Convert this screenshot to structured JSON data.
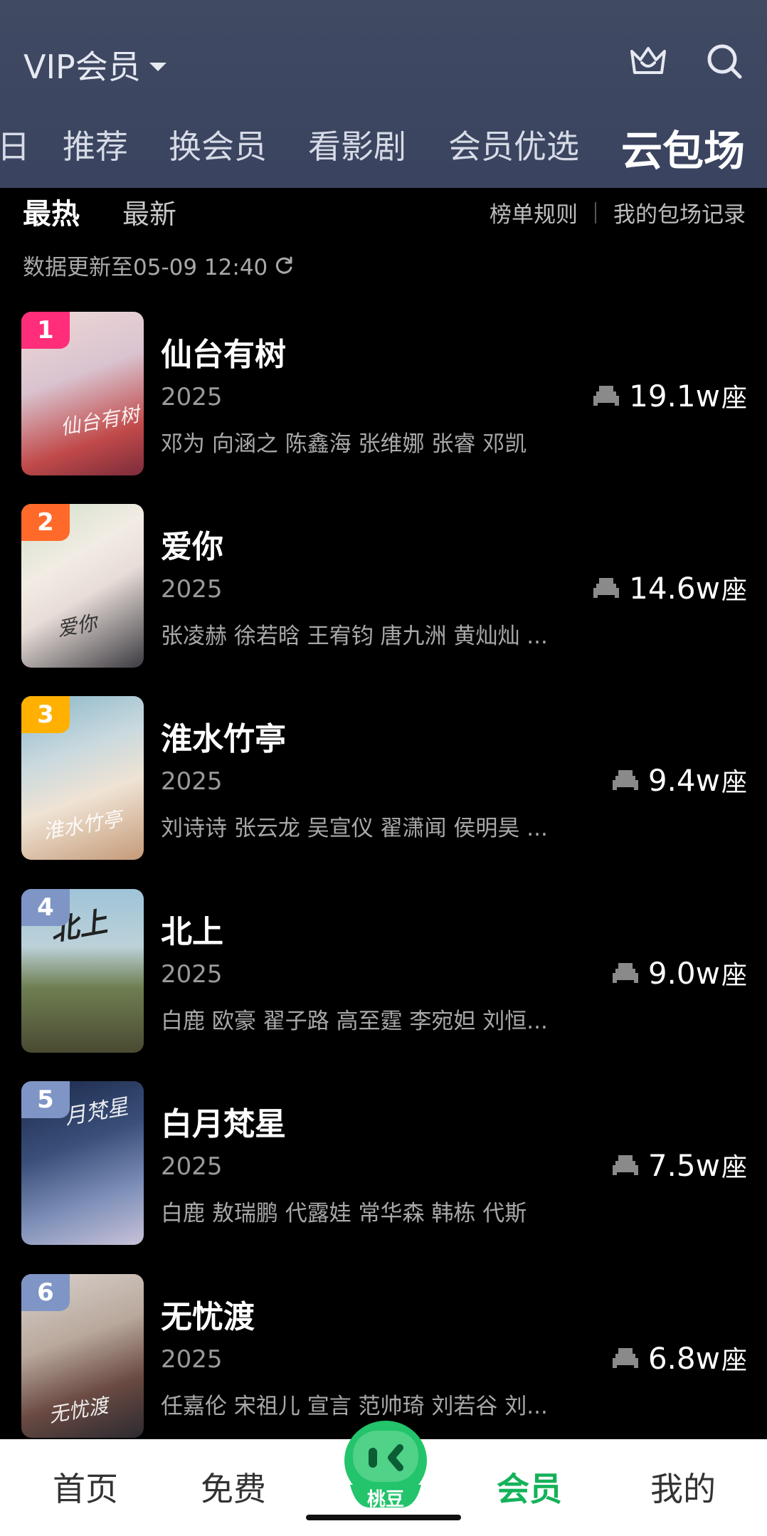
{
  "header": {
    "title": "VIP会员",
    "icons": [
      "crown-icon",
      "search-icon"
    ],
    "tabs": [
      {
        "label": "日"
      },
      {
        "label": "推荐"
      },
      {
        "label": "换会员"
      },
      {
        "label": "看影剧"
      },
      {
        "label": "会员优选"
      },
      {
        "label": "云包场"
      }
    ],
    "active_tab": "云包场"
  },
  "subbar": {
    "sort_hot": "最热",
    "sort_new": "最新",
    "rules": "榜单规则",
    "my_records": "我的包场记录"
  },
  "update": {
    "text": "数据更新至05-09 12:40"
  },
  "list": [
    {
      "rank": "1",
      "rank_color": "#ff2d7a",
      "title": "仙台有树",
      "year": "2025",
      "cast": "邓为 向涵之 陈鑫海 张维娜 张睿 邓凯",
      "seats": "19.1w",
      "unit": "座",
      "poster_text": "仙台有树"
    },
    {
      "rank": "2",
      "rank_color": "#ff6a2b",
      "title": "爱你",
      "year": "2025",
      "cast": "张凌赫 徐若晗 王宥钧 唐九洲 黄灿灿 ...",
      "seats": "14.6w",
      "unit": "座",
      "poster_text": "爱你"
    },
    {
      "rank": "3",
      "rank_color": "#ffb000",
      "title": "淮水竹亭",
      "year": "2025",
      "cast": "刘诗诗 张云龙 吴宣仪 翟潇闻 侯明昊 ...",
      "seats": "9.4w",
      "unit": "座",
      "poster_text": "淮水竹亭"
    },
    {
      "rank": "4",
      "rank_color": "#7f95c6",
      "title": "北上",
      "year": "2025",
      "cast": "白鹿 欧豪 翟子路 高至霆 李宛妲 刘恒...",
      "seats": "9.0w",
      "unit": "座",
      "poster_text": "北上"
    },
    {
      "rank": "5",
      "rank_color": "#7f95c6",
      "title": "白月梵星",
      "year": "2025",
      "cast": "白鹿 敖瑞鹏 代露娃 常华森 韩栋 代斯",
      "seats": "7.5w",
      "unit": "座",
      "poster_text": "月梵星"
    },
    {
      "rank": "6",
      "rank_color": "#7f95c6",
      "title": "无忧渡",
      "year": "2025",
      "cast": "任嘉伦 宋祖儿 宣言 范帅琦 刘若谷 刘...",
      "seats": "6.8w",
      "unit": "座",
      "poster_text": "无忧渡"
    }
  ],
  "bottom_nav": {
    "items": [
      "首页",
      "免费",
      "桃豆",
      "会员",
      "我的"
    ],
    "active": "会员"
  }
}
